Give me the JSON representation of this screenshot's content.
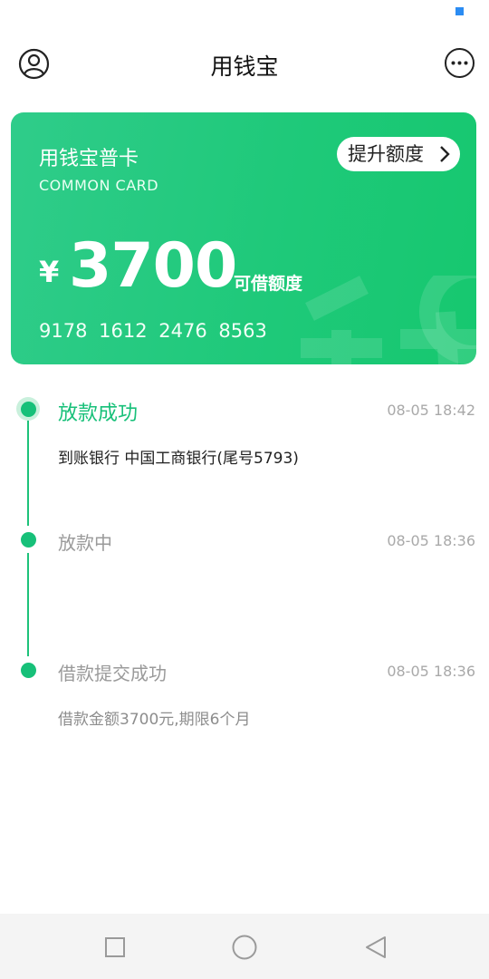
{
  "header": {
    "title": "用钱宝",
    "avatar_icon": "user-circle-icon",
    "more_icon": "more-horizontal-icon"
  },
  "card": {
    "name": "用钱宝普卡",
    "subtitle": "COMMON CARD",
    "upgrade_label": "提升额度",
    "currency": "¥",
    "amount": "3700",
    "amount_label": "可借额度",
    "card_number": "9178 1612 2476 8563",
    "watermark_icon": "money-watermark-icon"
  },
  "timeline": [
    {
      "title": "放款成功",
      "time": "08-05 18:42",
      "desc": "到账银行 中国工商银行(尾号5793)",
      "active": true
    },
    {
      "title": "放款中",
      "time": "08-05 18:36",
      "desc": "",
      "active": false
    },
    {
      "title": "借款提交成功",
      "time": "08-05 18:36",
      "desc": "借款金额3700元,期限6个月",
      "active": false
    }
  ],
  "navbar": {
    "recent_icon": "square-icon",
    "home_icon": "circle-icon",
    "back_icon": "triangle-back-icon"
  },
  "colors": {
    "accent": "#17c079",
    "card_gradient_start": "#2fcc8a",
    "card_gradient_end": "#16c86f",
    "muted_text": "#a9a9a9"
  }
}
